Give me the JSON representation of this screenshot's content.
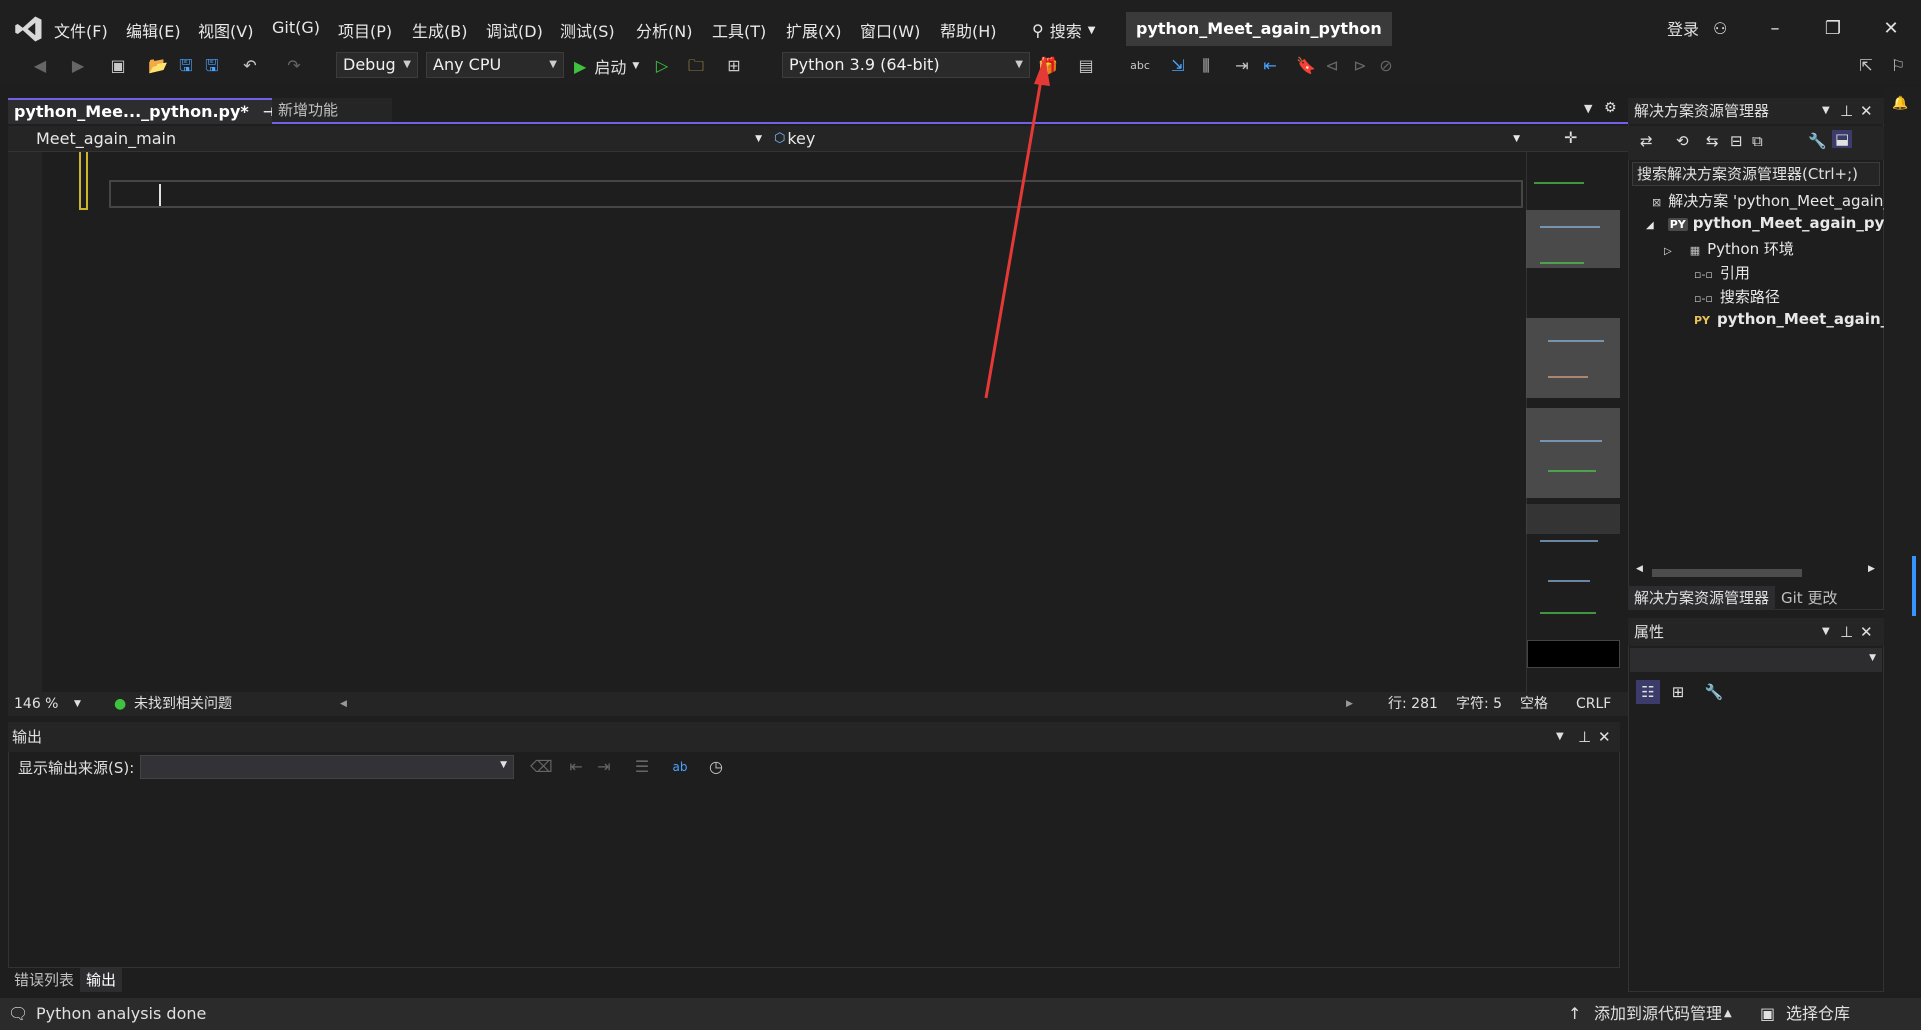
{
  "menu": {
    "items": [
      "文件(F)",
      "编辑(E)",
      "视图(V)",
      "Git(G)",
      "项目(P)",
      "生成(B)",
      "调试(D)",
      "测试(S)",
      "分析(N)",
      "工具(T)",
      "扩展(X)",
      "窗口(W)",
      "帮助(H)"
    ],
    "search_label": "搜索",
    "solution_title": "python_Meet_again_python",
    "sign_in": "登录"
  },
  "toolbar": {
    "config": "Debug",
    "platform": "Any CPU",
    "start_label": "启动",
    "environment": "Python 3.9 (64-bit)"
  },
  "editor": {
    "active_tab": "python_Mee..._python.py*",
    "second_tab": "新增功能",
    "nav_left": "Meet_again_main",
    "nav_right": "key",
    "zoom": "146 %",
    "issues": "未找到相关问题",
    "line": "行: 281",
    "char": "字符: 5",
    "whitespace": "空格",
    "eol": "CRLF"
  },
  "output": {
    "title": "输出",
    "source_label": "显示输出来源(S):",
    "bottom_tabs": [
      "错误列表",
      "输出"
    ]
  },
  "solution_explorer": {
    "title": "解决方案资源管理器",
    "search_placeholder": "搜索解决方案资源管理器(Ctrl+;)",
    "tree": {
      "solution": "解决方案 'python_Meet_again_python'",
      "project": "python_Meet_again_python",
      "env": "Python 环境",
      "refs": "引用",
      "paths": "搜索路径",
      "file": "python_Meet_again_python.py"
    },
    "tabs": [
      "解决方案资源管理器",
      "Git 更改"
    ]
  },
  "properties": {
    "title": "属性"
  },
  "status": {
    "message": "Python analysis done",
    "add_source": "添加到源代码管理",
    "select_repo": "选择仓库"
  },
  "colors": {
    "accent": "#7160e8",
    "annotation_arrow": "#e53935",
    "run_green": "#3fc33f"
  }
}
